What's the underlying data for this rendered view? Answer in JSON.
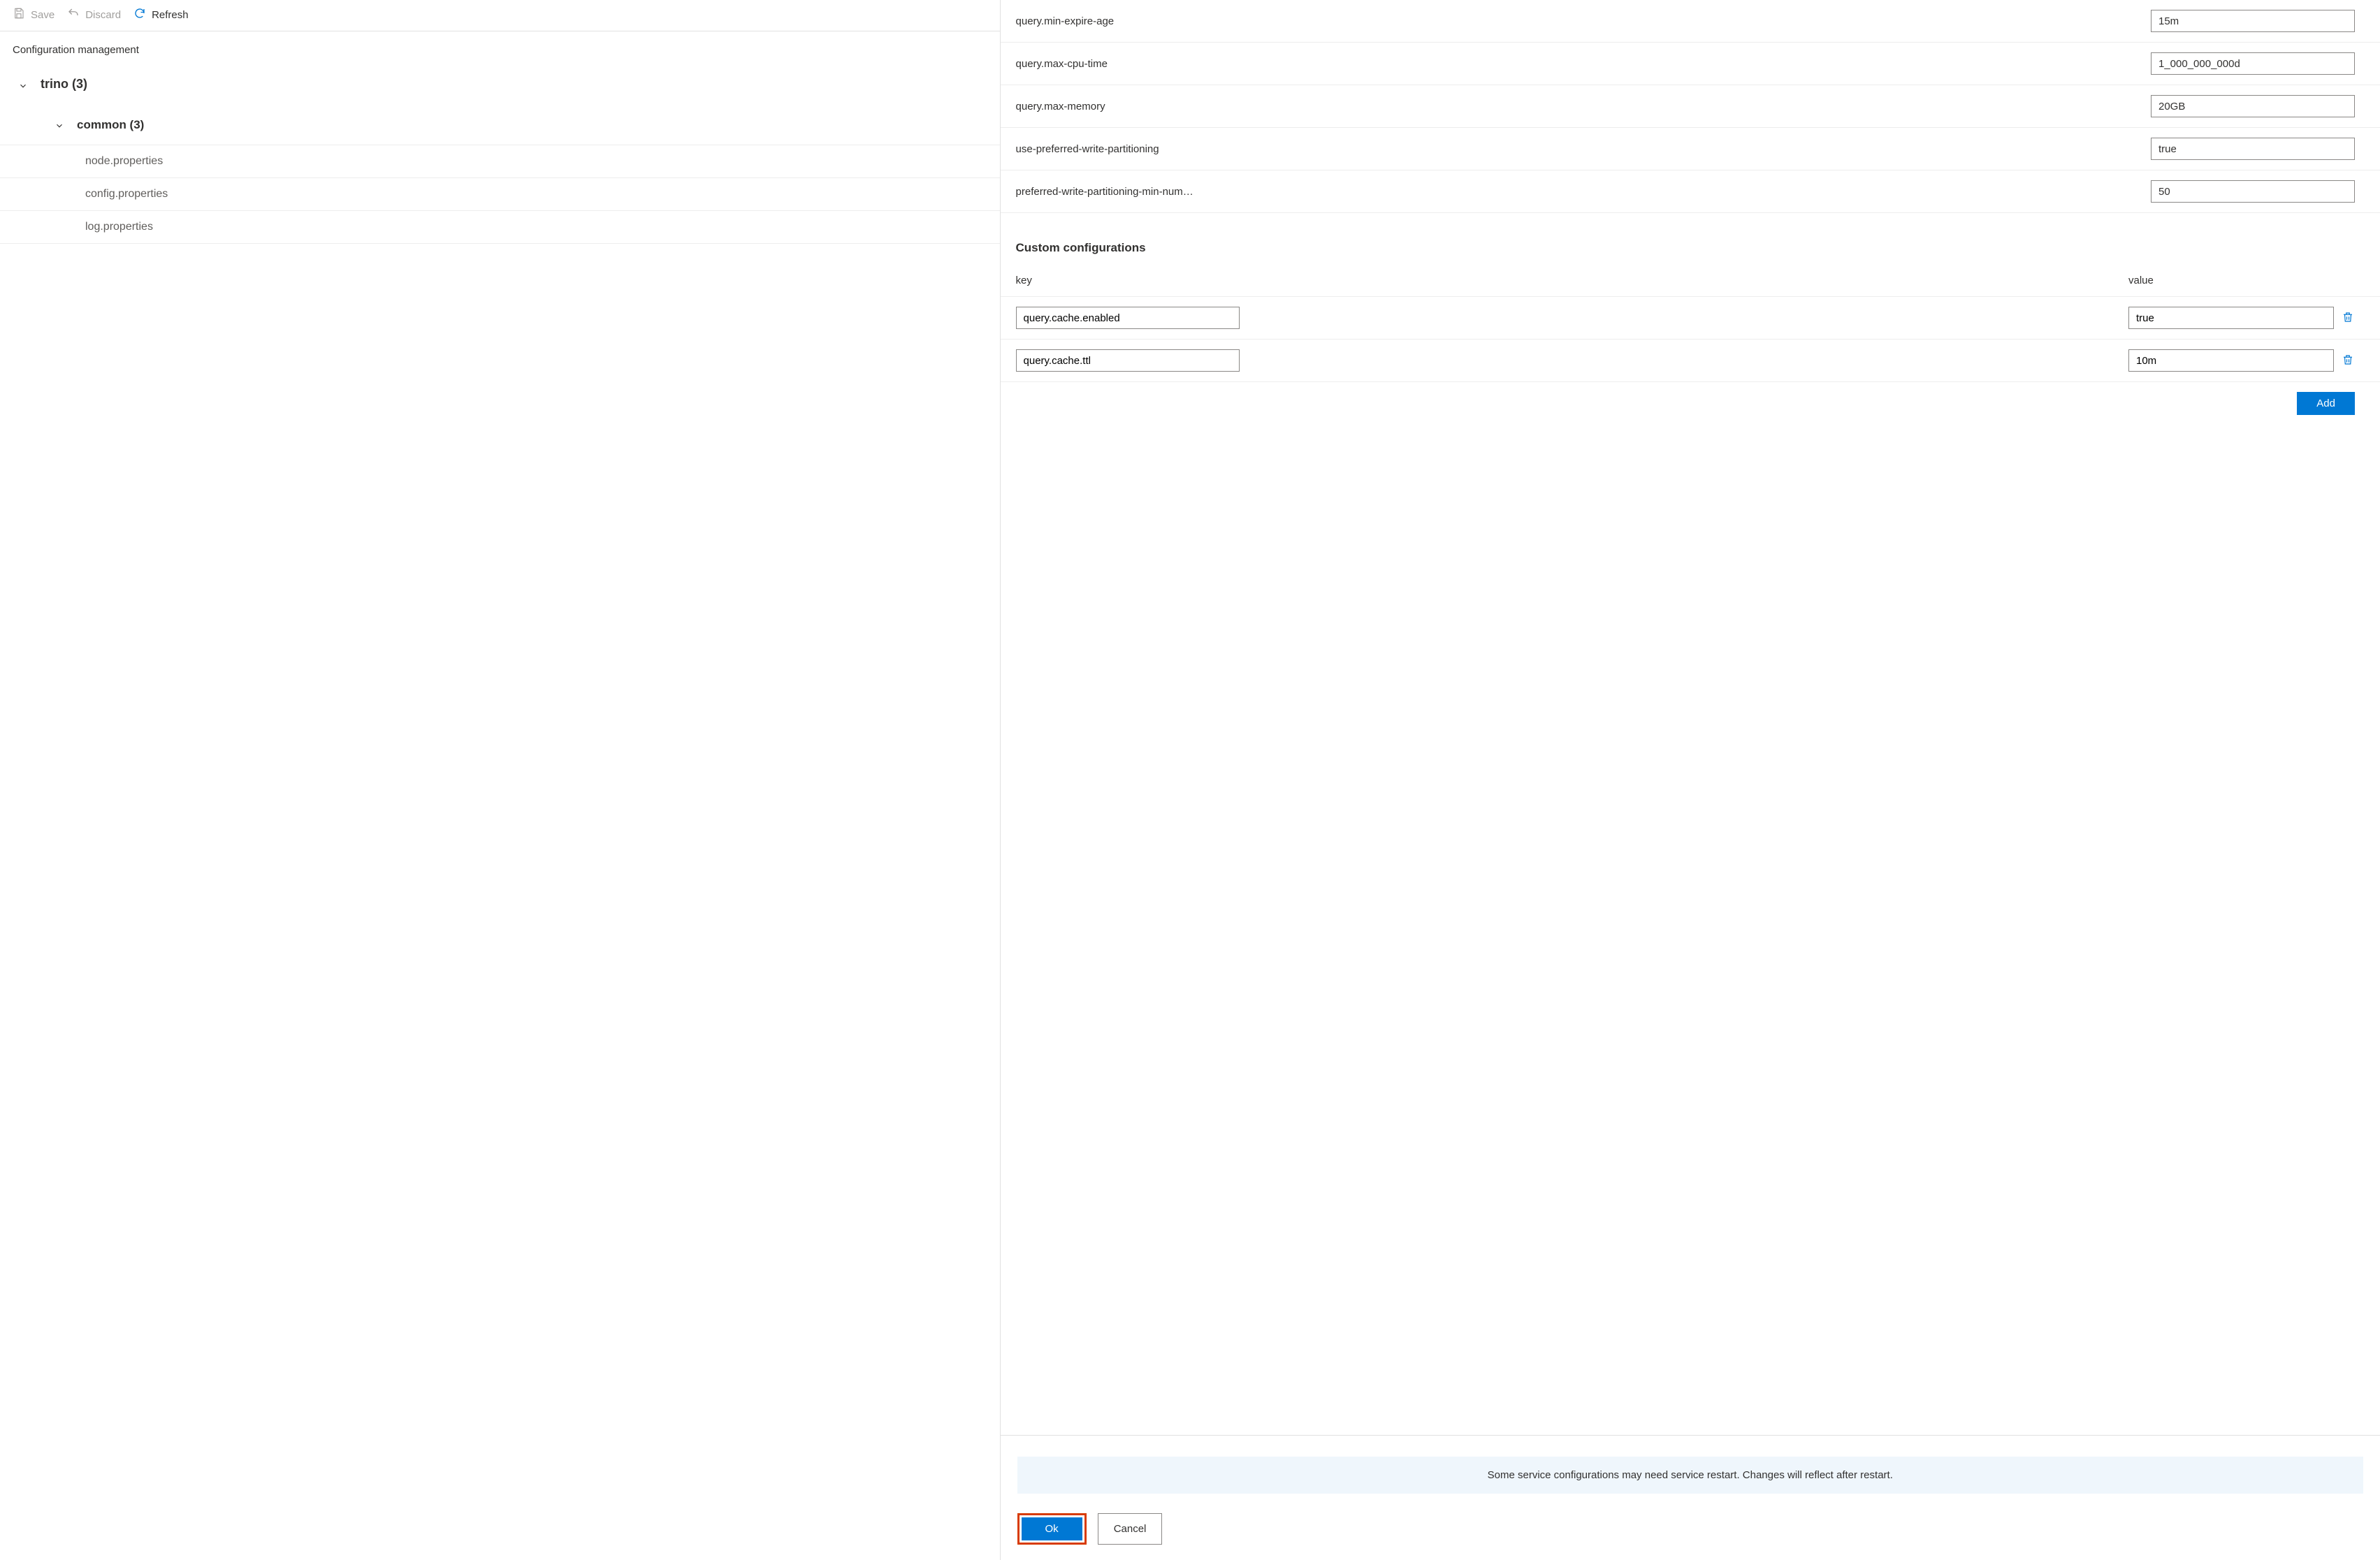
{
  "toolbar": {
    "save_label": "Save",
    "discard_label": "Discard",
    "refresh_label": "Refresh"
  },
  "section_title": "Configuration management",
  "tree": {
    "root": {
      "label": "trino (3)"
    },
    "common": {
      "label": "common (3)"
    },
    "files": [
      {
        "label": "node.properties"
      },
      {
        "label": "config.properties"
      },
      {
        "label": "log.properties"
      }
    ]
  },
  "configs": [
    {
      "label": "query.min-expire-age",
      "value": "15m"
    },
    {
      "label": "query.max-cpu-time",
      "value": "1_000_000_000d"
    },
    {
      "label": "query.max-memory",
      "value": "20GB"
    },
    {
      "label": "use-preferred-write-partitioning",
      "value": "true"
    },
    {
      "label": "preferred-write-partitioning-min-num…",
      "value": "50"
    }
  ],
  "custom": {
    "heading": "Custom configurations",
    "key_header": "key",
    "value_header": "value",
    "rows": [
      {
        "key": "query.cache.enabled",
        "value": "true"
      },
      {
        "key": "query.cache.ttl",
        "value": "10m"
      }
    ],
    "add_label": "Add"
  },
  "footer": {
    "banner": "Some service configurations may need service restart. Changes will reflect after restart.",
    "ok_label": "Ok",
    "cancel_label": "Cancel"
  }
}
